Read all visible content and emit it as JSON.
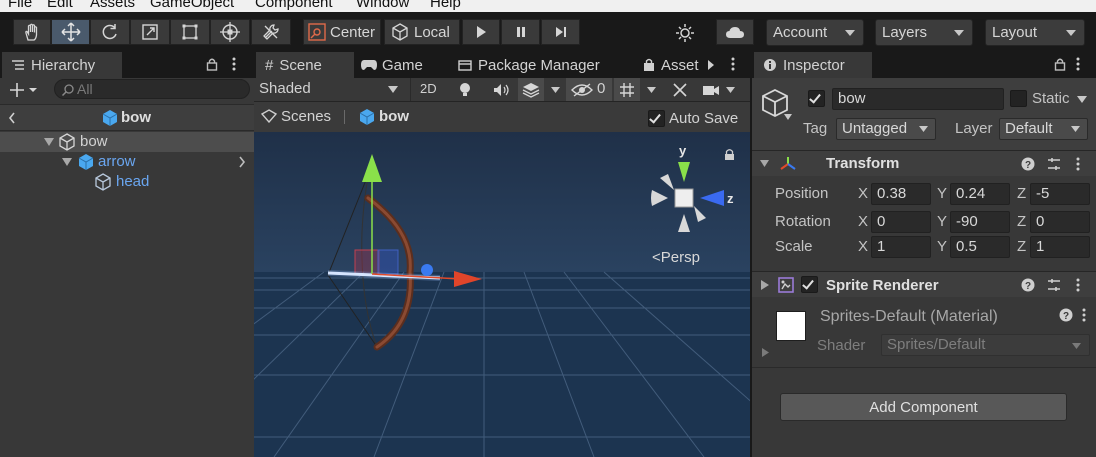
{
  "menu": [
    "File",
    "Edit",
    "Assets",
    "GameObject",
    "Component",
    "Window",
    "Help"
  ],
  "toolbar": {
    "tools": [
      "hand-tool",
      "move-tool",
      "rotate-tool",
      "scale-tool",
      "rect-tool",
      "transform-tool",
      "custom-tool"
    ],
    "pivot_label": "Center",
    "space_label": "Local",
    "account_label": "Account",
    "layers_label": "Layers",
    "layout_label": "Layout"
  },
  "hierarchy": {
    "tab_label": "Hierarchy",
    "search_placeholder": "All",
    "breadcrumb": "bow",
    "items": [
      {
        "label": "bow",
        "color": "#d2d2d2"
      },
      {
        "label": "arrow",
        "color": "#6aa6f0"
      },
      {
        "label": "head",
        "color": "#6aa6f0"
      }
    ]
  },
  "scene": {
    "tabs": [
      "Scene",
      "Game",
      "Package Manager",
      "Asset"
    ],
    "shading_mode": "Shaded",
    "mode_2d": "2D",
    "hidden_count": "0",
    "breadcrumb_root": "Scenes",
    "breadcrumb_current": "bow",
    "auto_save_label": "Auto Save",
    "auto_save_checked": true,
    "gizmo_y": "y",
    "gizmo_z": "z",
    "projection_label": "<Persp",
    "colors": {
      "sky": "#24364d",
      "ground": "#1c3450",
      "grid": "#4f6a8a"
    }
  },
  "inspector": {
    "tab_label": "Inspector",
    "object_name": "bow",
    "active_checked": true,
    "static_label": "Static",
    "tag_label": "Tag",
    "tag_value": "Untagged",
    "layer_label": "Layer",
    "layer_value": "Default",
    "transform": {
      "title": "Transform",
      "position_label": "Position",
      "rotation_label": "Rotation",
      "scale_label": "Scale",
      "axis_x": "X",
      "axis_y": "Y",
      "axis_z": "Z",
      "position": {
        "x": "0.38",
        "y": "0.24",
        "z": "-5"
      },
      "rotation": {
        "x": "0",
        "y": "-90",
        "z": "0"
      },
      "scale": {
        "x": "1",
        "y": "0.5",
        "z": "1"
      }
    },
    "sprite_renderer": {
      "title": "Sprite Renderer",
      "material_name": "Sprites-Default (Material)",
      "shader_label": "Shader",
      "shader_value": "Sprites/Default"
    },
    "add_component_label": "Add Component"
  }
}
